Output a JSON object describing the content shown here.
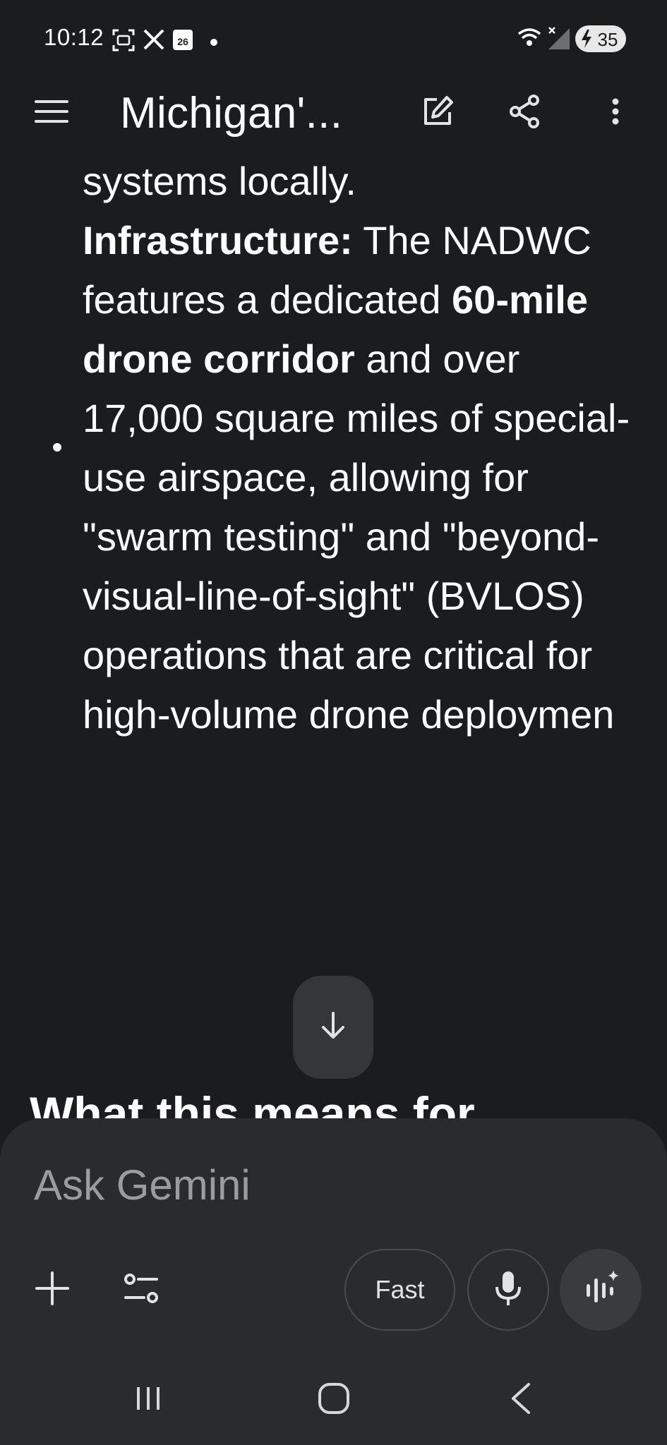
{
  "status_bar": {
    "time": "10:12",
    "calendar_day": "26",
    "battery": "35",
    "icons": [
      "screenshot-icon",
      "x-app-icon",
      "calendar-icon",
      "notification-dot-icon",
      "wifi-icon",
      "signal-icon",
      "battery-icon"
    ]
  },
  "app_bar": {
    "title": "Michigan'...",
    "icons": [
      "menu-icon",
      "edit-icon",
      "share-icon",
      "more-vert-icon"
    ]
  },
  "content": {
    "line_top": "systems locally.",
    "bullet": {
      "label": "Infrastructure:",
      "text1": " The NADWC features a dedicated ",
      "bold2": "60-mile drone corridor",
      "text2": " and over 17,000 square miles of special-use airspace, allowing for \"swarm testing\" and \"beyond-visual-line-of-sight\" (BVLOS) operations that are critical for high-volume drone deploymen"
    },
    "next_heading": "What this means for"
  },
  "scroll_button": {
    "icon": "arrow-down-icon"
  },
  "input": {
    "placeholder": "Ask Gemini",
    "fast_label": "Fast",
    "icons": [
      "plus-icon",
      "tools-icon",
      "mic-icon",
      "live-icon"
    ]
  },
  "nav": {
    "icons": [
      "recents-icon",
      "home-icon",
      "back-icon"
    ]
  },
  "colors": {
    "background": "#1b1c1e",
    "panel": "#2a2b2e",
    "text": "#ffffff",
    "placeholder": "#9a9ca0"
  }
}
